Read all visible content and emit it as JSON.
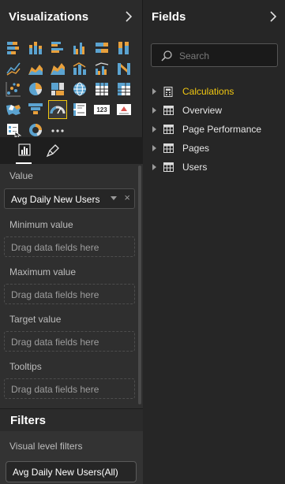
{
  "visualizations": {
    "title": "Visualizations",
    "tabs": [
      "fields-tab",
      "format-tab"
    ],
    "wells": [
      {
        "label": "Value",
        "field": "Avg Daily New Users",
        "filled": true
      },
      {
        "label": "Minimum value",
        "field": "Drag data fields here",
        "filled": false
      },
      {
        "label": "Maximum value",
        "field": "Drag data fields here",
        "filled": false
      },
      {
        "label": "Target value",
        "field": "Drag data fields here",
        "filled": false
      },
      {
        "label": "Tooltips",
        "field": "Drag data fields here",
        "filled": false
      }
    ],
    "gallery_icons": [
      "stacked-bar-chart-icon",
      "stacked-column-chart-icon",
      "clustered-bar-chart-icon",
      "clustered-column-chart-icon",
      "100-stacked-bar-chart-icon",
      "100-stacked-column-chart-icon",
      "line-chart-icon",
      "area-chart-icon",
      "stacked-area-chart-icon",
      "line-and-stacked-column-chart-icon",
      "line-and-clustered-column-chart-icon",
      "ribbon-chart-icon",
      "scatter-chart-icon",
      "pie-chart-icon",
      "treemap-icon",
      "map-icon",
      "table-icon",
      "matrix-icon",
      "filled-map-icon",
      "funnel-chart-icon",
      "gauge-icon",
      "multi-row-card-icon",
      "card-icon",
      "kpi-icon",
      "slicer-icon",
      "donut-chart-icon",
      "more-visuals-icon"
    ],
    "selected_icon": "gauge-icon",
    "card_text": "123"
  },
  "filters": {
    "title": "Filters",
    "section_label": "Visual level filters",
    "chip": "Avg Daily New Users(All)"
  },
  "fields": {
    "title": "Fields",
    "search_placeholder": "Search",
    "tables": [
      {
        "name": "Calculations",
        "icon": "calculator-icon",
        "accent": true
      },
      {
        "name": "Overview",
        "icon": "table-icon",
        "accent": false
      },
      {
        "name": "Page Performance",
        "icon": "table-icon",
        "accent": false
      },
      {
        "name": "Pages",
        "icon": "table-icon",
        "accent": false
      },
      {
        "name": "Users",
        "icon": "table-icon",
        "accent": false
      }
    ]
  },
  "colors": {
    "accent": "#f2c811",
    "chart_blue": "#5ba3d0",
    "chart_orange": "#e8a03c"
  }
}
